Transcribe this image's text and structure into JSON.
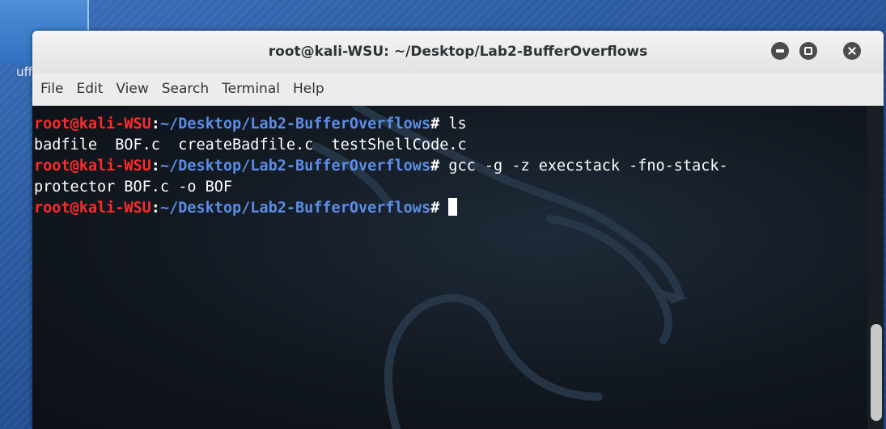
{
  "desktop": {
    "icon_label": "uff"
  },
  "window": {
    "title": "root@kali-WSU: ~/Desktop/Lab2-BufferOverflows",
    "controls": [
      "minimize-icon",
      "maximize-icon",
      "close-icon"
    ]
  },
  "menu": {
    "items": [
      "File",
      "Edit",
      "View",
      "Search",
      "Terminal",
      "Help"
    ]
  },
  "terminal": {
    "prompt_user": "root@kali-WSU",
    "prompt_sep": ":",
    "prompt_path": "~/Desktop/Lab2-BufferOverflows",
    "prompt_hash": "#",
    "cmd1": " ls",
    "output1": "badfile  BOF.c  createBadfile.c  testShellCode.c",
    "cmd2": " gcc -g -z execstack -fno-stack-",
    "cmd2_wrap": "protector BOF.c -o BOF",
    "cmd3": " "
  },
  "colors": {
    "prompt_user": "#ff2a2a",
    "prompt_path": "#5c8ee8",
    "terminal_bg": "#121820"
  }
}
